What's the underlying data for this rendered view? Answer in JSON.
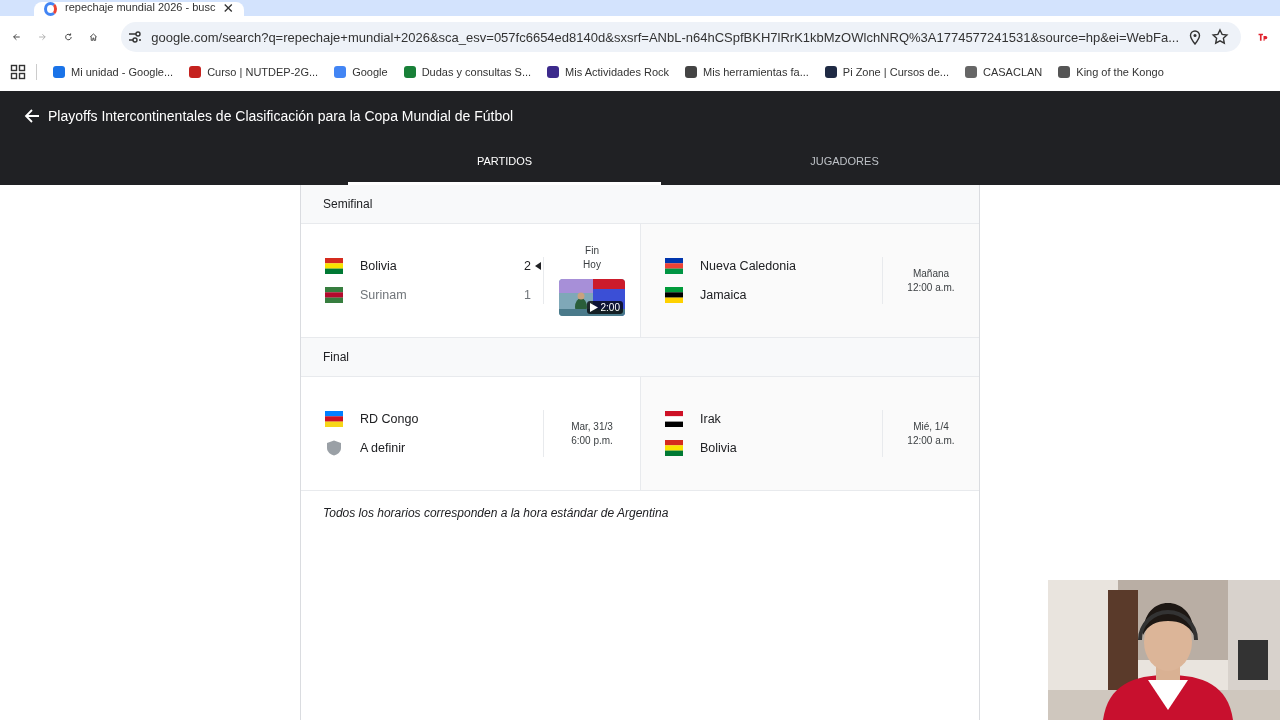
{
  "browser": {
    "tab_title": "repechaje mundial 2026 - busc",
    "url": "google.com/search?q=repechaje+mundial+2026&sca_esv=057fc6654ed8140d&sxsrf=ANbL-n64hCSpfBKH7lRrK1kbMzOWlchNRQ%3A1774577241531&source=hp&ei=WebFa...",
    "bookmarks": [
      {
        "label": "Mi unidad - Google..."
      },
      {
        "label": "Curso | NUTDEP-2G..."
      },
      {
        "label": "Google"
      },
      {
        "label": "Dudas y consultas S..."
      },
      {
        "label": "Mis Actividades Rock"
      },
      {
        "label": "Mis herramientas fa..."
      },
      {
        "label": "Pi Zone | Cursos de..."
      },
      {
        "label": "CASACLAN"
      },
      {
        "label": "King of the Kongo"
      }
    ]
  },
  "header": {
    "title": "Playoffs Intercontinentales de Clasificación para la Copa Mundial de Fútbol"
  },
  "tabs": [
    {
      "label": "PARTIDOS",
      "selected": true
    },
    {
      "label": "JUGADORES",
      "selected": false
    }
  ],
  "rounds": [
    {
      "name": "Semifinal",
      "matches": [
        {
          "teams": [
            {
              "name": "Bolivia",
              "kind": "flag",
              "score": "2",
              "winner": true
            },
            {
              "name": "Surinam",
              "kind": "flag",
              "score": "1",
              "winner": false
            }
          ],
          "status": "Fin",
          "date": "Hoy",
          "video": {
            "duration": "2:00"
          }
        },
        {
          "teams": [
            {
              "name": "Nueva Caledonia",
              "kind": "flag"
            },
            {
              "name": "Jamaica",
              "kind": "flag"
            }
          ],
          "date": "Mañana",
          "time": "12:00 a.m."
        }
      ]
    },
    {
      "name": "Final",
      "matches": [
        {
          "teams": [
            {
              "name": "RD Congo",
              "kind": "flag"
            },
            {
              "name": "A definir",
              "kind": "unknown"
            }
          ],
          "date": "Mar, 31/3",
          "time": "6:00 p.m."
        },
        {
          "teams": [
            {
              "name": "Irak",
              "kind": "flag"
            },
            {
              "name": "Bolivia",
              "kind": "flag"
            }
          ],
          "date": "Mié, 1/4",
          "time": "12:00 a.m."
        }
      ]
    }
  ],
  "footnote": "Todos los horarios corresponden a la hora estándar de Argentina"
}
